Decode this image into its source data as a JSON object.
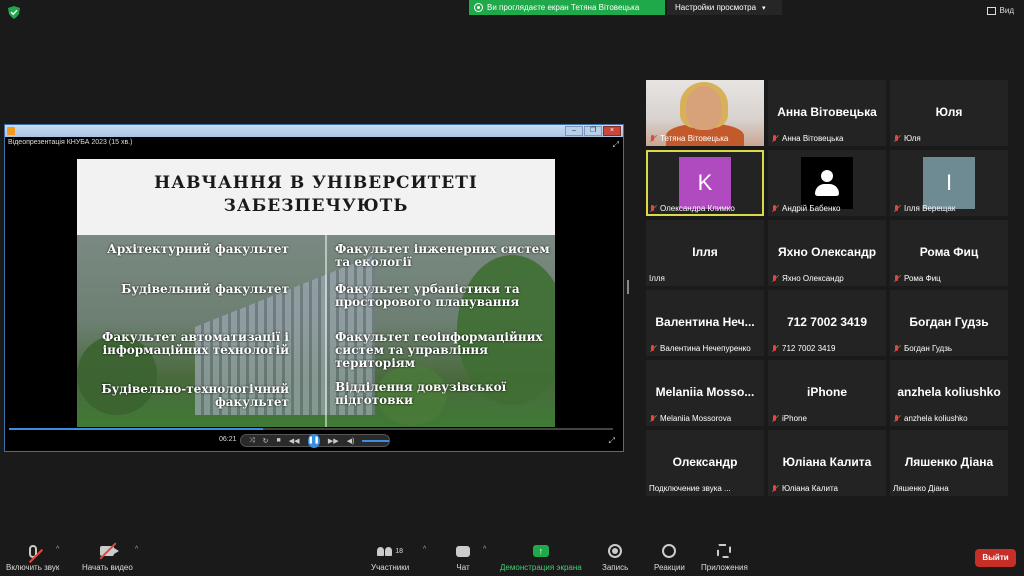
{
  "top": {
    "share_banner": "Ви проглядаєте екран Тетяна Вітовецька",
    "view_settings": "Настройки просмотра",
    "view": "Вид"
  },
  "player": {
    "filename": "Відеопрезентація КНУБА 2023 (15 хв.)",
    "time": "06:21",
    "progress": 0.42,
    "slide": {
      "title_line1": "НАВЧАННЯ В УНІВЕРСИТЕТІ",
      "title_line2": "ЗАБЕЗПЕЧУЮТЬ",
      "left": [
        "Архітектурний факультет",
        "Будівельний факультет",
        "Факультет автоматизації і інформаційних технологій",
        "Будівельно-технологічний факультет"
      ],
      "right": [
        "Факультет інженерних систем та екології",
        "Факультет урбаністики та просторового планування",
        "Факультет геоінформаційних систем та управління територіям",
        "Відділення довузівської підготовки"
      ]
    }
  },
  "participants": [
    {
      "big": "",
      "label": "Тетяна Вітовецька",
      "muted": true,
      "kind": "photo"
    },
    {
      "big": "Анна Вітовецька",
      "label": "Анна Вітовецька",
      "muted": true,
      "kind": "name"
    },
    {
      "big": "Юля",
      "label": "Юля",
      "muted": true,
      "kind": "name"
    },
    {
      "big": "K",
      "label": "Олександра Климко",
      "muted": true,
      "kind": "avatar-k"
    },
    {
      "big": "",
      "label": "Андрій Бабенко",
      "muted": true,
      "kind": "avatar-user"
    },
    {
      "big": "I",
      "label": "Ілля Верещак",
      "muted": true,
      "kind": "avatar-i"
    },
    {
      "big": "Ілля",
      "label": "Ілля",
      "muted": false,
      "kind": "name"
    },
    {
      "big": "Яхно Олександр",
      "label": "Яхно Олександр",
      "muted": true,
      "kind": "name"
    },
    {
      "big": "Рома Фиц",
      "label": "Рома Фиц",
      "muted": true,
      "kind": "name"
    },
    {
      "big": "Валентина Неч...",
      "label": "Валентина Нечепуренко",
      "muted": true,
      "kind": "name"
    },
    {
      "big": "712 7002 3419",
      "label": "712 7002 3419",
      "muted": true,
      "kind": "name"
    },
    {
      "big": "Богдан Гудзь",
      "label": "Богдан Гудзь",
      "muted": true,
      "kind": "name"
    },
    {
      "big": "Melaniia Mosso...",
      "label": "Melaniia Mossorova",
      "muted": true,
      "kind": "name"
    },
    {
      "big": "iPhone",
      "label": "iPhone",
      "muted": true,
      "kind": "name"
    },
    {
      "big": "anzhela koliushko",
      "label": "anzhela koliushko",
      "muted": true,
      "kind": "name"
    },
    {
      "big": "Олександр",
      "label": "Подключение звука ...",
      "muted": false,
      "kind": "name"
    },
    {
      "big": "Юліана Калита",
      "label": "Юліана Калита",
      "muted": true,
      "kind": "name"
    },
    {
      "big": "Ляшенко Діана",
      "label": "Ляшенко Діана",
      "muted": false,
      "kind": "name"
    }
  ],
  "toolbar": {
    "mic": "Включить звук",
    "video": "Начать видео",
    "participants": "Участники",
    "participants_count": "18",
    "chat": "Чат",
    "share": "Демонстрация экрана",
    "record": "Запись",
    "reactions": "Реакции",
    "apps": "Приложения",
    "leave": "Выйти"
  }
}
